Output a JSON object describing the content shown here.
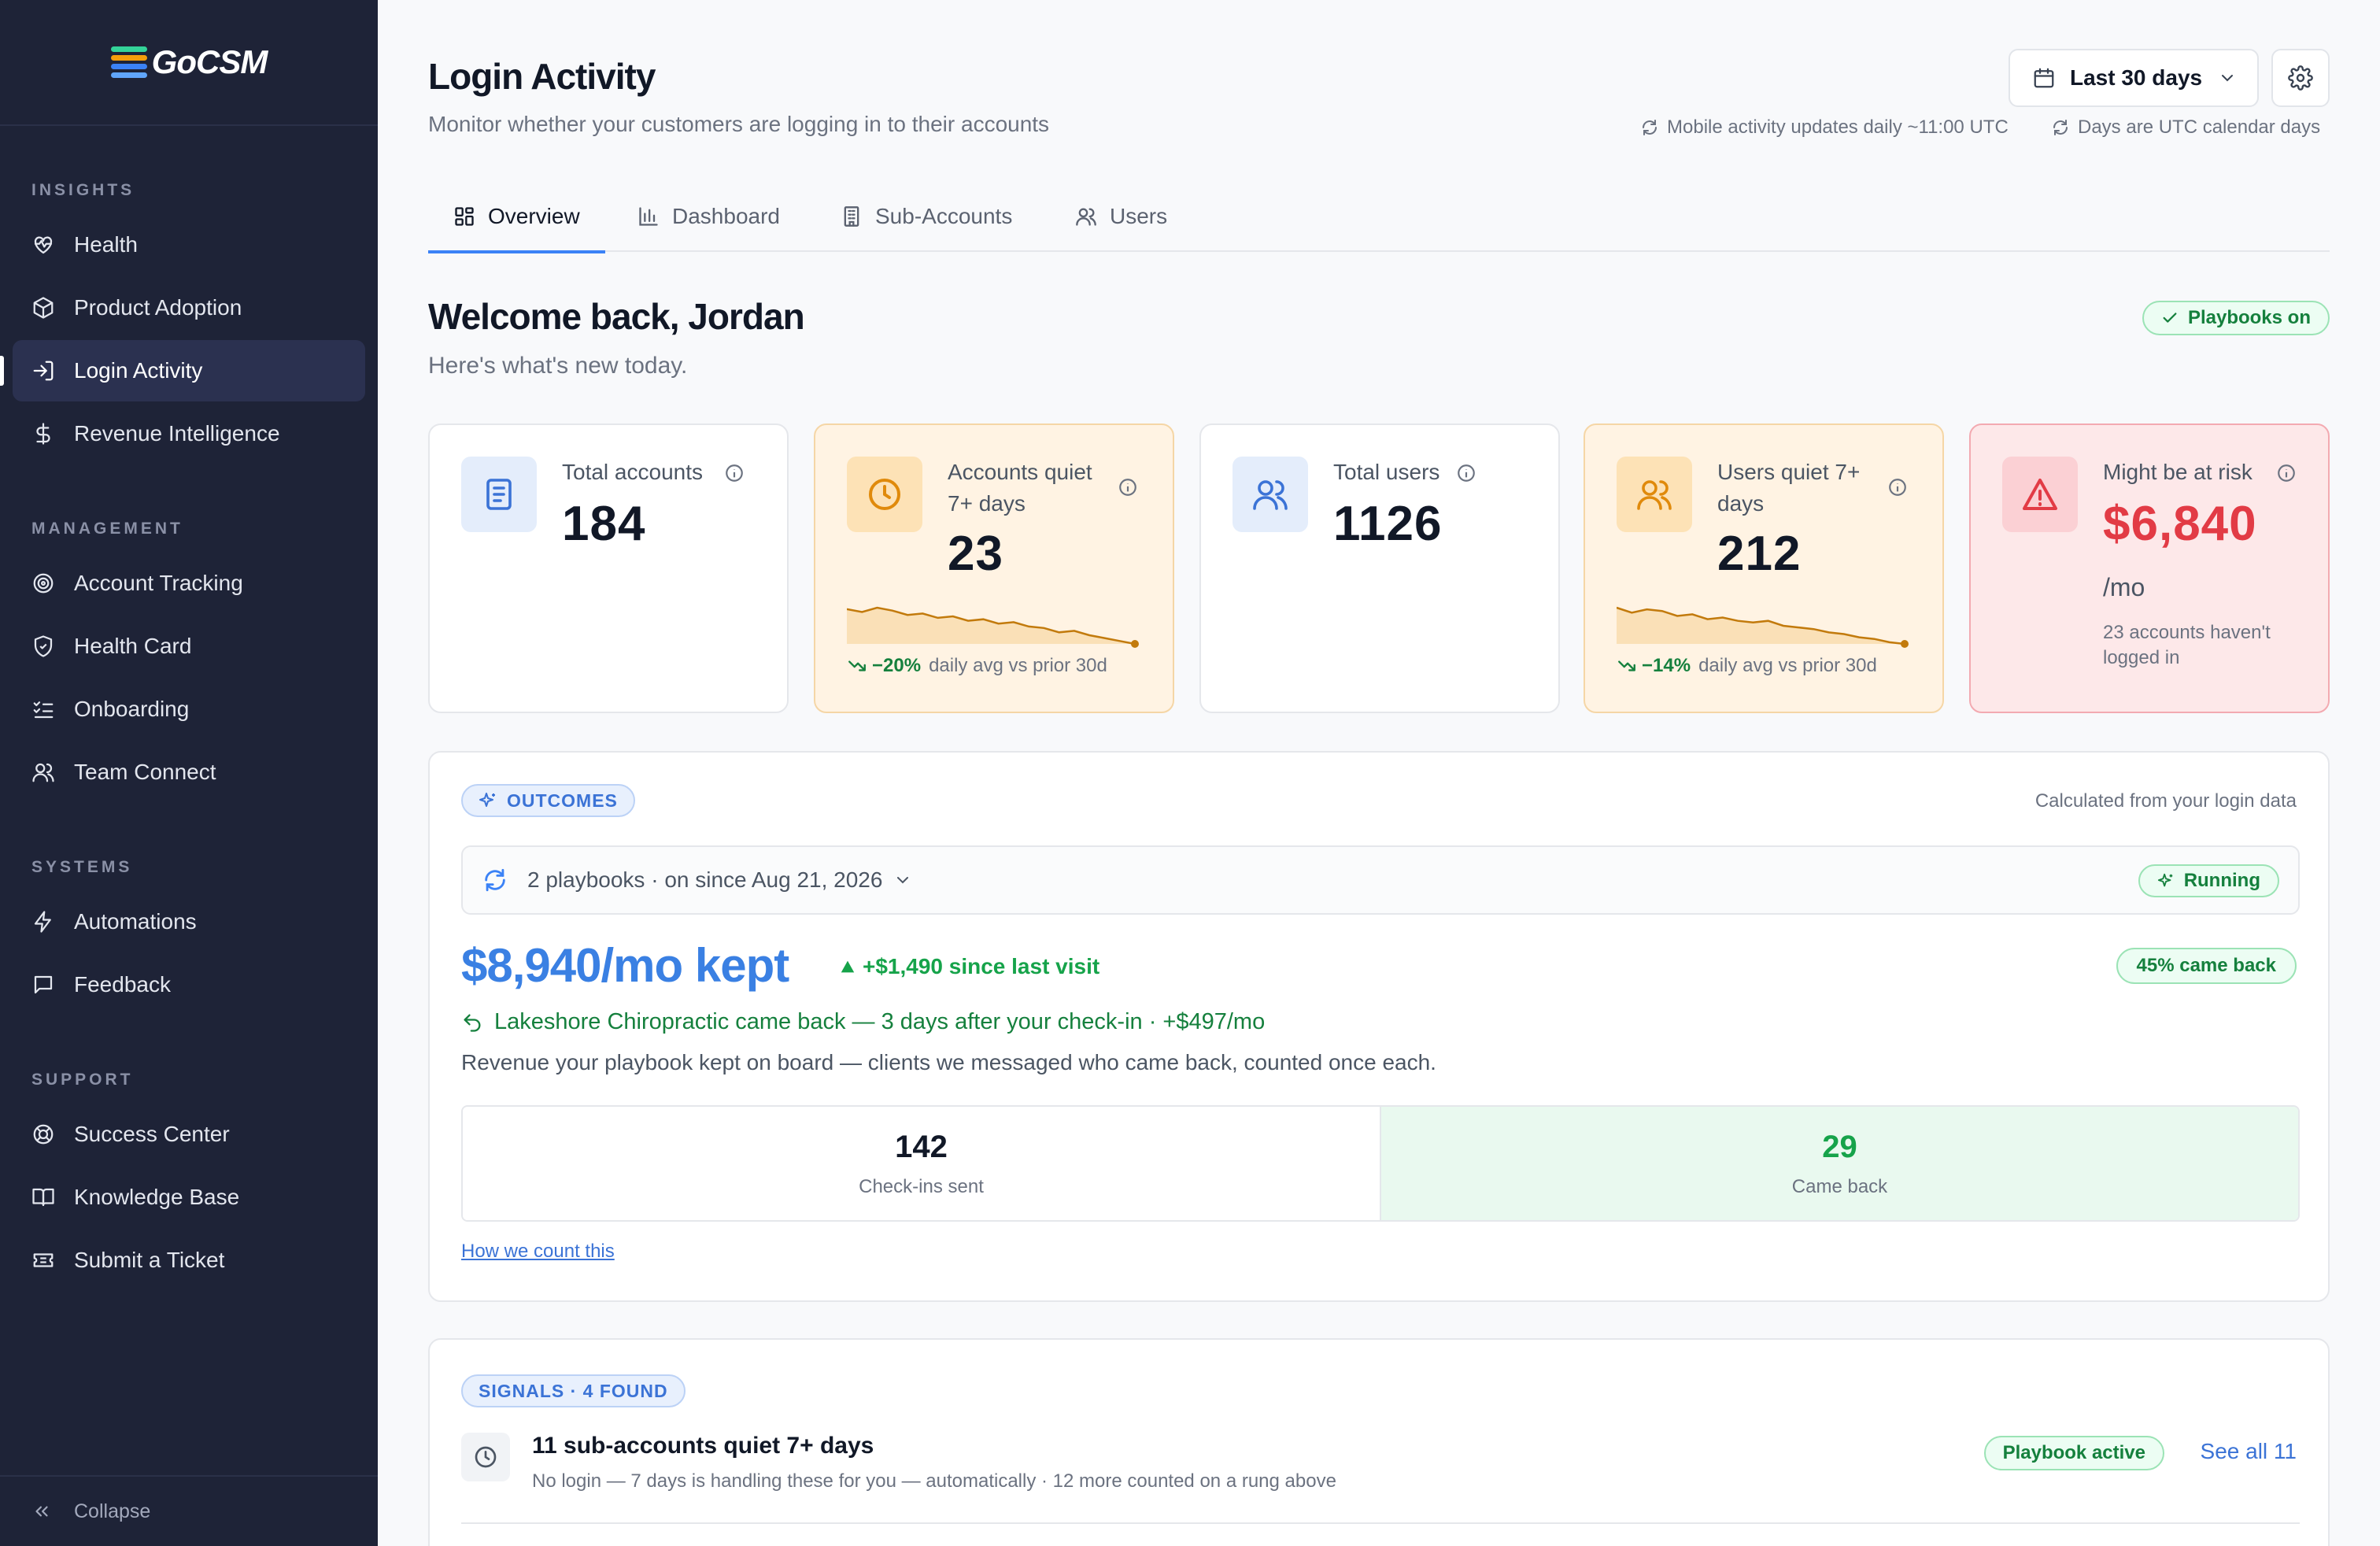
{
  "brand": {
    "name": "GoCSM",
    "stripe_colors": [
      "#34d399",
      "#f59e0b",
      "#3b82f6",
      "#60a5fa"
    ]
  },
  "sidebar": {
    "sections": [
      {
        "title": "INSIGHTS",
        "items": [
          {
            "label": "Health",
            "icon": "heart-pulse-icon"
          },
          {
            "label": "Product Adoption",
            "icon": "box-icon"
          },
          {
            "label": "Login Activity",
            "icon": "login-icon",
            "active": true
          },
          {
            "label": "Revenue Intelligence",
            "icon": "dollar-icon"
          }
        ]
      },
      {
        "title": "MANAGEMENT",
        "items": [
          {
            "label": "Account Tracking",
            "icon": "target-icon"
          },
          {
            "label": "Health Card",
            "icon": "shield-icon"
          },
          {
            "label": "Onboarding",
            "icon": "checklist-icon"
          },
          {
            "label": "Team Connect",
            "icon": "users-icon"
          }
        ]
      },
      {
        "title": "SYSTEMS",
        "items": [
          {
            "label": "Automations",
            "icon": "lightning-icon"
          },
          {
            "label": "Feedback",
            "icon": "message-icon"
          }
        ]
      },
      {
        "title": "SUPPORT",
        "items": [
          {
            "label": "Success Center",
            "icon": "lifebuoy-icon"
          },
          {
            "label": "Knowledge Base",
            "icon": "book-icon"
          },
          {
            "label": "Submit a Ticket",
            "icon": "ticket-icon"
          }
        ]
      }
    ],
    "collapse_label": "Collapse"
  },
  "header": {
    "title": "Login Activity",
    "subtitle": "Monitor whether your customers are logging in to their accounts",
    "date_range": "Last 30 days",
    "note_mobile": "Mobile activity updates daily ~11:00 UTC",
    "note_utc": "Days are UTC calendar days"
  },
  "tabs": [
    {
      "label": "Overview",
      "icon": "grid-icon",
      "active": true
    },
    {
      "label": "Dashboard",
      "icon": "bar-chart-icon"
    },
    {
      "label": "Sub-Accounts",
      "icon": "building-icon"
    },
    {
      "label": "Users",
      "icon": "users-icon"
    }
  ],
  "welcome": {
    "title": "Welcome back, Jordan",
    "subtitle": "Here's what's new today.",
    "playbooks_badge": "Playbooks on"
  },
  "cards": [
    {
      "label": "Total accounts",
      "value": "184",
      "icon": "document-icon"
    },
    {
      "label": "Accounts quiet 7+ days",
      "value": "23",
      "icon": "clock-icon",
      "trend_pct": "−20%",
      "trend_text": "daily avg vs prior 30d",
      "spark": [
        30,
        28,
        31,
        29,
        26,
        27,
        24,
        25,
        22,
        23,
        20,
        21,
        18,
        17,
        14,
        15,
        12,
        10,
        8,
        6
      ]
    },
    {
      "label": "Total users",
      "value": "1126",
      "icon": "users-icon"
    },
    {
      "label": "Users quiet 7+ days",
      "value": "212",
      "icon": "users-icon",
      "trend_pct": "−14%",
      "trend_text": "daily avg vs prior 30d",
      "spark": [
        30,
        27,
        29,
        28,
        25,
        26,
        23,
        24,
        22,
        21,
        22,
        19,
        18,
        17,
        15,
        14,
        12,
        11,
        9,
        8
      ]
    },
    {
      "label": "Might be at risk",
      "value": "$6,840",
      "unit": "/mo",
      "note": "23 accounts haven't logged in",
      "icon": "warning-icon"
    }
  ],
  "outcomes": {
    "tag": "OUTCOMES",
    "calc_note": "Calculated from your login data",
    "playbooks_text": "2 playbooks · on since Aug 21, 2026",
    "running": "Running",
    "kept": "$8,940/mo kept",
    "delta": "+$1,490 since last visit",
    "came_back_pct": "45% came back",
    "story": "Lakeshore Chiropractic came back — 3 days after your check-in · +$497/mo",
    "description": "Revenue your playbook kept on board — clients we messaged who came back, counted once each.",
    "stats": [
      {
        "value": "142",
        "label": "Check-ins sent"
      },
      {
        "value": "29",
        "label": "Came back"
      }
    ],
    "link": "How we count this"
  },
  "signals": {
    "tag": "SIGNALS · 4 FOUND",
    "items": [
      {
        "title": "11 sub-accounts quiet 7+ days",
        "subtitle": "No login — 7 days is handling these for you — automatically · 12 more counted on a rung above",
        "badge": "Playbook active",
        "link": "See all 11"
      }
    ]
  }
}
